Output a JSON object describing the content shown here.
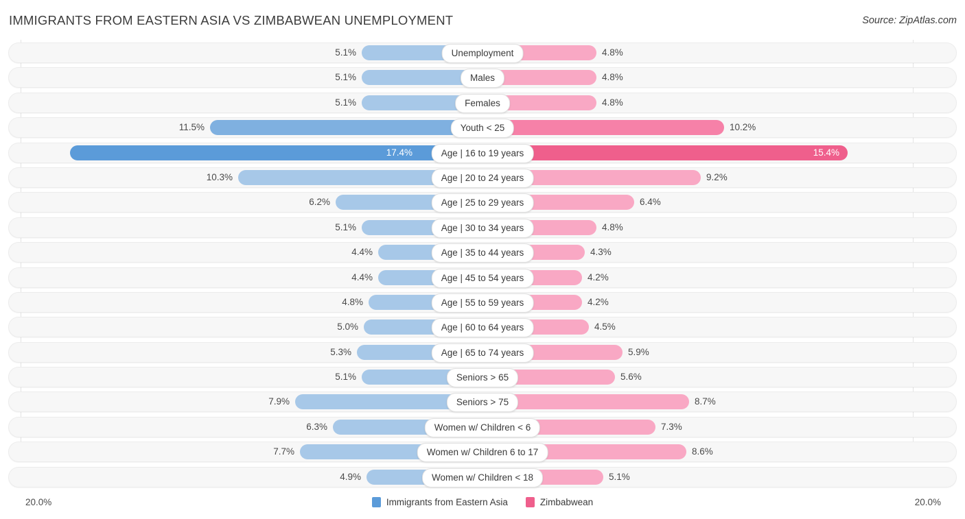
{
  "header": {
    "title": "IMMIGRANTS FROM EASTERN ASIA VS ZIMBABWEAN UNEMPLOYMENT",
    "source": "Source: ZipAtlas.com"
  },
  "axis": {
    "min_label": "20.0%",
    "max_label": "20.0%",
    "scale_max": 20.0
  },
  "legend": {
    "items": [
      {
        "label": "Immigrants from Eastern Asia",
        "color": "#5b9bd9"
      },
      {
        "label": "Zimbabwean",
        "color": "#ef5f8c"
      }
    ]
  },
  "colors": {
    "left_light": "#a7c8e8",
    "left_mid": "#7fb0e0",
    "left_dark": "#5b9bd9",
    "right_light": "#f9a8c4",
    "right_mid": "#f681a8",
    "right_dark": "#ef5f8c",
    "track_bg": "#f7f7f7",
    "track_border": "#ececec",
    "grid": "#e3e3e3"
  },
  "chart_data": {
    "type": "bar",
    "orientation": "diverging-horizontal",
    "title": "IMMIGRANTS FROM EASTERN ASIA VS ZIMBABWEAN UNEMPLOYMENT",
    "xlabel": "",
    "ylabel": "",
    "xlim": [
      20.0,
      20.0
    ],
    "grid": true,
    "legend_position": "bottom-center",
    "categories": [
      "Unemployment",
      "Males",
      "Females",
      "Youth < 25",
      "Age | 16 to 19 years",
      "Age | 20 to 24 years",
      "Age | 25 to 29 years",
      "Age | 30 to 34 years",
      "Age | 35 to 44 years",
      "Age | 45 to 54 years",
      "Age | 55 to 59 years",
      "Age | 60 to 64 years",
      "Age | 65 to 74 years",
      "Seniors > 65",
      "Seniors > 75",
      "Women w/ Children < 6",
      "Women w/ Children 6 to 17",
      "Women w/ Children < 18"
    ],
    "series": [
      {
        "name": "Immigrants from Eastern Asia",
        "color": "#5b9bd9",
        "values": [
          5.1,
          5.1,
          5.1,
          11.5,
          17.4,
          10.3,
          6.2,
          5.1,
          4.4,
          4.4,
          4.8,
          5.0,
          5.3,
          5.1,
          7.9,
          6.3,
          7.7,
          4.9
        ],
        "labels": [
          "5.1%",
          "5.1%",
          "5.1%",
          "11.5%",
          "17.4%",
          "10.3%",
          "6.2%",
          "5.1%",
          "4.4%",
          "4.4%",
          "4.8%",
          "5.0%",
          "5.3%",
          "5.1%",
          "7.9%",
          "6.3%",
          "7.7%",
          "4.9%"
        ]
      },
      {
        "name": "Zimbabwean",
        "color": "#ef5f8c",
        "values": [
          4.8,
          4.8,
          4.8,
          10.2,
          15.4,
          9.2,
          6.4,
          4.8,
          4.3,
          4.2,
          4.2,
          4.5,
          5.9,
          5.6,
          8.7,
          7.3,
          8.6,
          5.1
        ],
        "labels": [
          "4.8%",
          "4.8%",
          "4.8%",
          "10.2%",
          "15.4%",
          "9.2%",
          "6.4%",
          "4.8%",
          "4.3%",
          "4.2%",
          "4.2%",
          "4.5%",
          "5.9%",
          "5.6%",
          "8.7%",
          "7.3%",
          "8.6%",
          "5.1%"
        ]
      }
    ]
  }
}
